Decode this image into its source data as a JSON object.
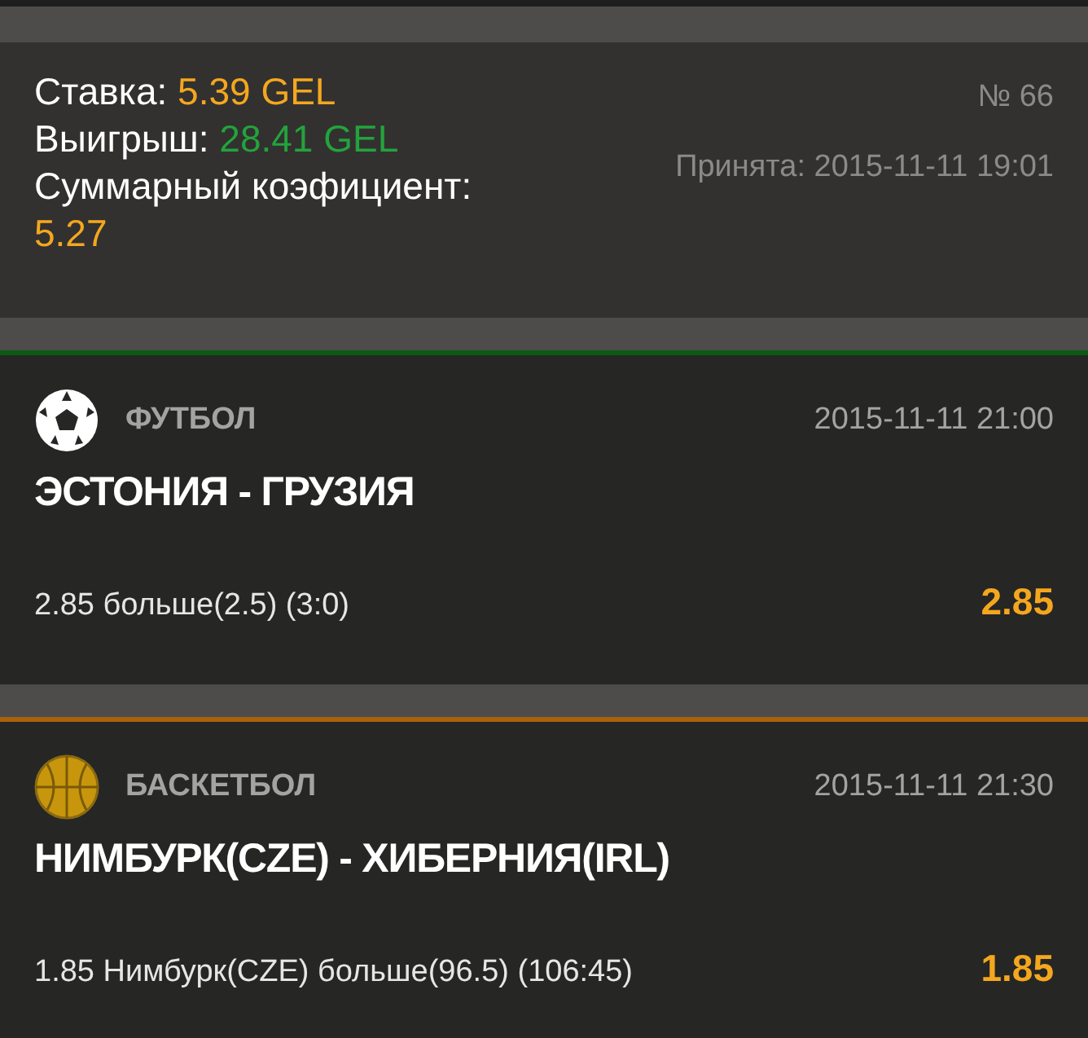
{
  "summary": {
    "stake_label": "Ставка:",
    "stake": "5.39 GEL",
    "win_label": "Выигрыш:",
    "win": "28.41 GEL",
    "odds_label": "Суммарный коэфициент:",
    "odds": "5.27",
    "number": "№ 66",
    "accepted": "Принята: 2015-11-11 19:01"
  },
  "events": [
    {
      "kind": "football",
      "sport": "ФУТБОЛ",
      "time": "2015-11-11 21:00",
      "match": "ЭСТОНИЯ - ГРУЗИЯ",
      "bet": "2.85 больше(2.5) (3:0)",
      "odds": "2.85"
    },
    {
      "kind": "basketball",
      "sport": "БАСКЕТБОЛ",
      "time": "2015-11-11 21:30",
      "match": "НИМБУРК(CZE) - ХИБЕРНИЯ(IRL)",
      "bet": "1.85 Нимбурк(CZE) больше(96.5) (106:45)",
      "odds": "1.85"
    }
  ]
}
